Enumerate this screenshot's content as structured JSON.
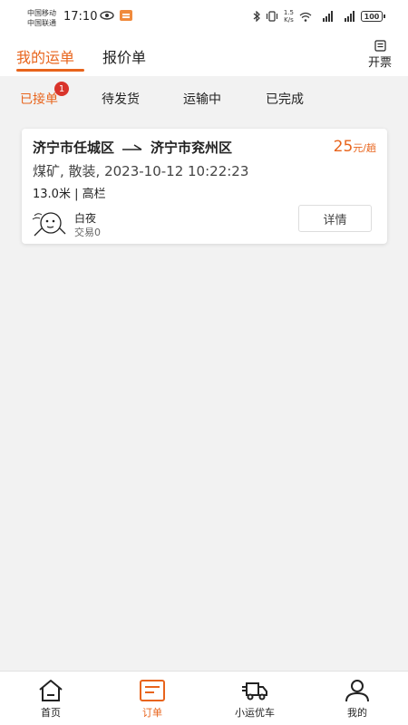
{
  "status_bar": {
    "carrier1": "中国移动",
    "carrier2": "中国联通",
    "time": "17:10",
    "net_speed_value": "1.5",
    "net_speed_unit": "K/s",
    "battery": "100"
  },
  "header": {
    "tabs": [
      {
        "label": "我的运单",
        "active": true
      },
      {
        "label": "报价单",
        "active": false
      }
    ],
    "invoice_label": "开票"
  },
  "sub_tabs": [
    {
      "label": "已接单",
      "active": true,
      "badge": "1"
    },
    {
      "label": "待发货",
      "active": false
    },
    {
      "label": "运输中",
      "active": false
    },
    {
      "label": "已完成",
      "active": false
    }
  ],
  "order": {
    "origin": "济宁市任城区",
    "destination": "济宁市兖州区",
    "price_amount": "25",
    "price_unit": "元/趟",
    "cargo": "煤矿, 散装, 2023-10-12 10:22:23",
    "spec": "13.0米 | 高栏",
    "shipper_name": "白夜",
    "shipper_trades": "交易0",
    "detail_label": "详情"
  },
  "bottom_nav": [
    {
      "label": "首页",
      "icon": "home-icon",
      "active": false
    },
    {
      "label": "订单",
      "icon": "order-icon",
      "active": true
    },
    {
      "label": "小运优车",
      "icon": "truck-icon",
      "active": false
    },
    {
      "label": "我的",
      "icon": "user-icon",
      "active": false
    }
  ],
  "colors": {
    "accent": "#e8641c",
    "badge": "#d9342b",
    "background": "#f2f2f2"
  }
}
